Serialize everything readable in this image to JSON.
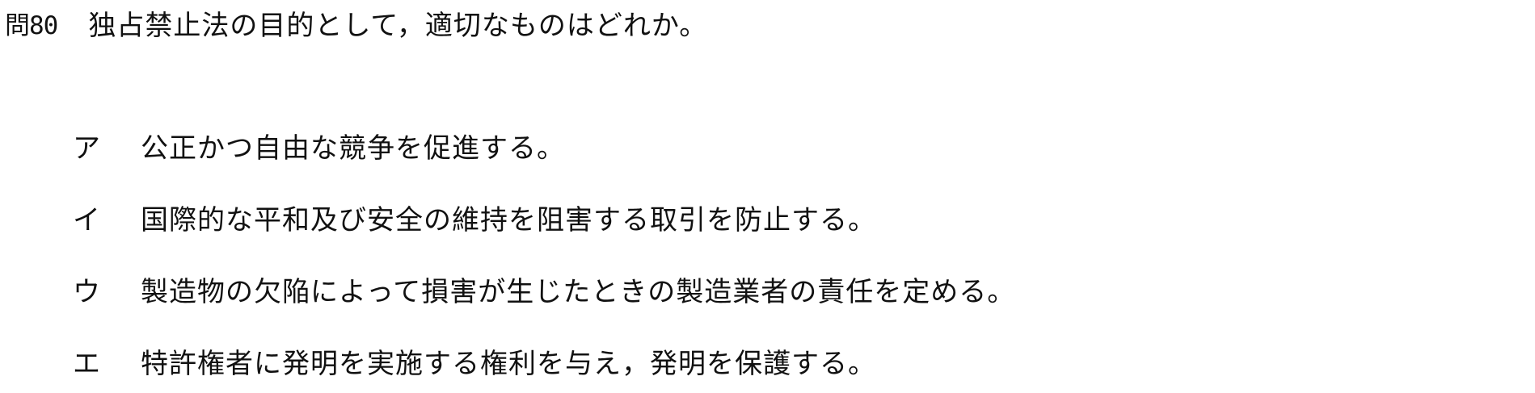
{
  "question": {
    "number": "問80",
    "text": "独占禁止法の目的として，適切なものはどれか。"
  },
  "choices": [
    {
      "label": "ア",
      "text": "公正かつ自由な競争を促進する。"
    },
    {
      "label": "イ",
      "text": "国際的な平和及び安全の維持を阻害する取引を防止する。"
    },
    {
      "label": "ウ",
      "text": "製造物の欠陥によって損害が生じたときの製造業者の責任を定める。"
    },
    {
      "label": "エ",
      "text": "特許権者に発明を実施する権利を与え，発明を保護する。"
    }
  ]
}
